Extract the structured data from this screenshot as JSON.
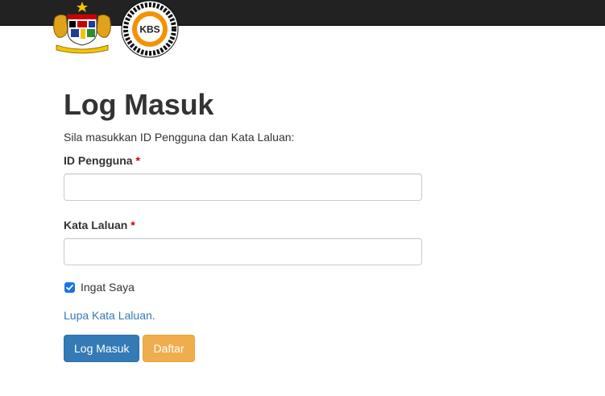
{
  "header": {
    "crest_logo": "malaysia-coat-of-arms-icon",
    "ministry_logo": "kbs-logo-icon",
    "ministry_logo_text": "KBS"
  },
  "form": {
    "title": "Log Masuk",
    "intro": "Sila masukkan ID Pengguna dan Kata Laluan:",
    "user_id_label": "ID Pengguna",
    "user_id_value": "",
    "password_label": "Kata Laluan",
    "password_value": "",
    "required_marker": "*",
    "remember_label": "Ingat Saya",
    "remember_checked": true,
    "forgot_link": "Lupa Kata Laluan.",
    "login_button": "Log Masuk",
    "register_button": "Daftar"
  },
  "colors": {
    "topbar": "#222222",
    "primary": "#337ab7",
    "warning": "#f0ad4e",
    "required": "#cc0000",
    "link": "#337ab7",
    "kbs_orange": "#f39200"
  }
}
